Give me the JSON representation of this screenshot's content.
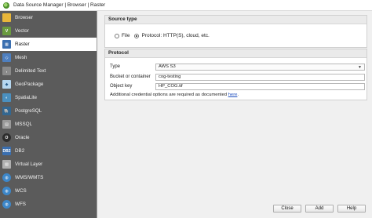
{
  "window": {
    "title": "Data Source Manager | Browser | Raster"
  },
  "sidebar": {
    "items": [
      {
        "label": "Browser",
        "icon": "folder-icon",
        "color": "#e8b63a"
      },
      {
        "label": "Vector",
        "icon": "vector-layer-icon",
        "color": "#6a9b3f"
      },
      {
        "label": "Raster",
        "icon": "raster-layer-icon",
        "color": "#3a6fb0"
      },
      {
        "label": "Mesh",
        "icon": "mesh-layer-icon",
        "color": "#4e7fbf"
      },
      {
        "label": "Delimited Text",
        "icon": "delimited-text-icon",
        "color": "#8a8a8a"
      },
      {
        "label": "GeoPackage",
        "icon": "geopackage-icon",
        "color": "#b6d7f0"
      },
      {
        "label": "SpatiaLite",
        "icon": "spatialite-icon",
        "color": "#4a90c0"
      },
      {
        "label": "PostgreSQL",
        "icon": "postgresql-icon",
        "color": "#336791"
      },
      {
        "label": "MSSQL",
        "icon": "mssql-icon",
        "color": "#9a9a9a"
      },
      {
        "label": "Oracle",
        "icon": "oracle-icon",
        "color": "#2d2d2d"
      },
      {
        "label": "DB2",
        "icon": "db2-icon",
        "color": "#3a6fb0"
      },
      {
        "label": "Virtual Layer",
        "icon": "virtual-layer-icon",
        "color": "#b0b0b0"
      },
      {
        "label": "WMS/WMTS",
        "icon": "wms-icon",
        "color": "#3d87c9"
      },
      {
        "label": "WCS",
        "icon": "wcs-icon",
        "color": "#3d87c9"
      },
      {
        "label": "WFS",
        "icon": "wfs-icon",
        "color": "#3d87c9"
      }
    ],
    "active_index": 2
  },
  "source_type": {
    "header": "Source type",
    "options": [
      "File",
      "Protocol: HTTP(S), cloud, etc."
    ],
    "selected": "Protocol: HTTP(S), cloud, etc."
  },
  "protocol": {
    "header": "Protocol",
    "type_label": "Type",
    "type_value": "AWS S3",
    "bucket_label": "Bucket or container",
    "bucket_value": "cog-testing",
    "object_label": "Object key",
    "object_value": "HP_COG.tif",
    "note_text": "Additional credential options are required as documented ",
    "note_link": "here",
    "note_end": "."
  },
  "buttons": {
    "close": "Close",
    "add": "Add",
    "help": "Help"
  }
}
